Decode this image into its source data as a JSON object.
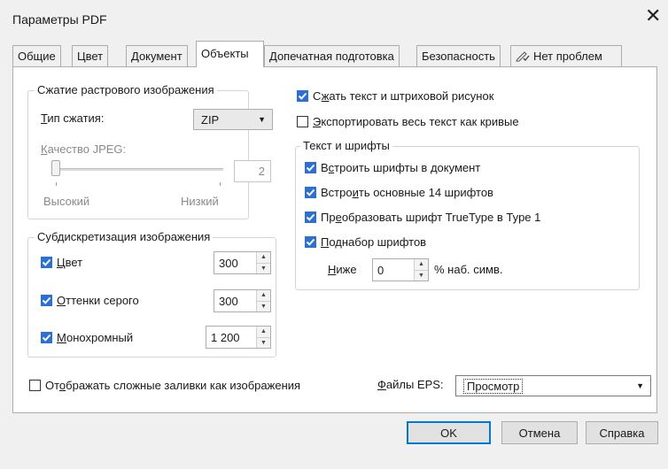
{
  "window": {
    "title": "Параметры PDF",
    "close_glyph": "✕"
  },
  "tabs": [
    {
      "label": "Общие"
    },
    {
      "label": "Цвет"
    },
    {
      "label": "Документ"
    },
    {
      "label": "Объекты"
    },
    {
      "label": "Допечатная подготовка"
    },
    {
      "label": "Безопасность"
    },
    {
      "label": "Нет проблем",
      "icon": "pencil-check-icon"
    }
  ],
  "compression": {
    "legend": "Сжатие растрового изображения",
    "type_label_u": "Т",
    "type_label_rest": "ип сжатия:",
    "type_value": "ZIP",
    "jpeg_label_u": "К",
    "jpeg_label_rest": "ачество JPEG:",
    "jpeg_value": "2",
    "slider_level": 0,
    "high_label": "Высокий",
    "low_label": "Низкий"
  },
  "downsample": {
    "legend": "Субдискретизация изображения",
    "color_u": "Ц",
    "color_rest": "вет",
    "color_value": "300",
    "color_checked": true,
    "gray_u": "О",
    "gray_rest": "ттенки серого",
    "gray_value": "300",
    "gray_checked": true,
    "mono_u": "М",
    "mono_rest": "онохромный",
    "mono_value": "1 200",
    "mono_checked": true
  },
  "compress_text": {
    "pre": "С",
    "u": "ж",
    "rest": "ать текст и штриховой рисунок",
    "checked": true
  },
  "export_curves": {
    "u": "Э",
    "rest": "кспортировать весь текст как кривые",
    "checked": false
  },
  "fonts": {
    "legend": "Текст и шрифты",
    "embed": {
      "pre": "В",
      "u": "с",
      "rest": "троить шрифты в документ",
      "checked": true
    },
    "base14": {
      "pre": "Встро",
      "u": "и",
      "rest": "ть основные 14 шрифтов",
      "checked": true
    },
    "truetype": {
      "pre": "Пр",
      "u": "е",
      "rest": "образовать шрифт TrueType в Type 1",
      "checked": true
    },
    "subset": {
      "u": "П",
      "rest": "однабор шрифтов",
      "checked": true
    },
    "below_u": "Н",
    "below_rest": "иже",
    "below_value": "0",
    "below_suffix": "% наб. симв."
  },
  "complex_fills": {
    "pre": "От",
    "u": "о",
    "rest": "бражать сложные заливки как изображения",
    "checked": false
  },
  "eps": {
    "label_u": "Ф",
    "label_rest": "айлы EPS:",
    "value": "Просмотр"
  },
  "buttons": {
    "ok": "OK",
    "cancel": "Отмена",
    "help": "Справка"
  },
  "colors": {
    "accent": "#0078d7",
    "checkbox": "#2b6fd8"
  }
}
